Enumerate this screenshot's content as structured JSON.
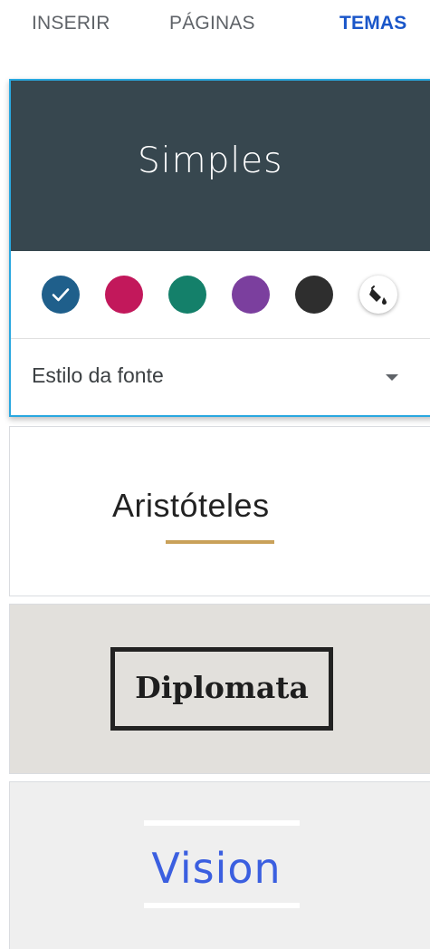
{
  "tabs": [
    {
      "label": "INSERIR",
      "active": false
    },
    {
      "label": "PÁGINAS",
      "active": false
    },
    {
      "label": "TEMAS",
      "active": true
    }
  ],
  "selected_theme": {
    "name": "Simples",
    "banner_color": "#37474f",
    "color_swatches": [
      {
        "color": "#1f5f8b",
        "selected": true,
        "icon": "checkmark-icon"
      },
      {
        "color": "#c2185b",
        "selected": false
      },
      {
        "color": "#14806a",
        "selected": false
      },
      {
        "color": "#7b3f9e",
        "selected": false
      },
      {
        "color": "#2e2e2e",
        "selected": false
      }
    ],
    "custom_color_icon": "paint-bucket-icon",
    "font_style_label": "Estilo da fonte",
    "font_style_icon": "dropdown-arrow-icon"
  },
  "themes": [
    {
      "name": "Aristóteles",
      "accent": "#c9a15a"
    },
    {
      "name": "Diplomata",
      "background": "#e2e0dc"
    },
    {
      "name": "Vision",
      "accent": "#3b5fe0"
    }
  ],
  "accent_color": "#1a56c9",
  "selection_border_color": "#29a8e0"
}
